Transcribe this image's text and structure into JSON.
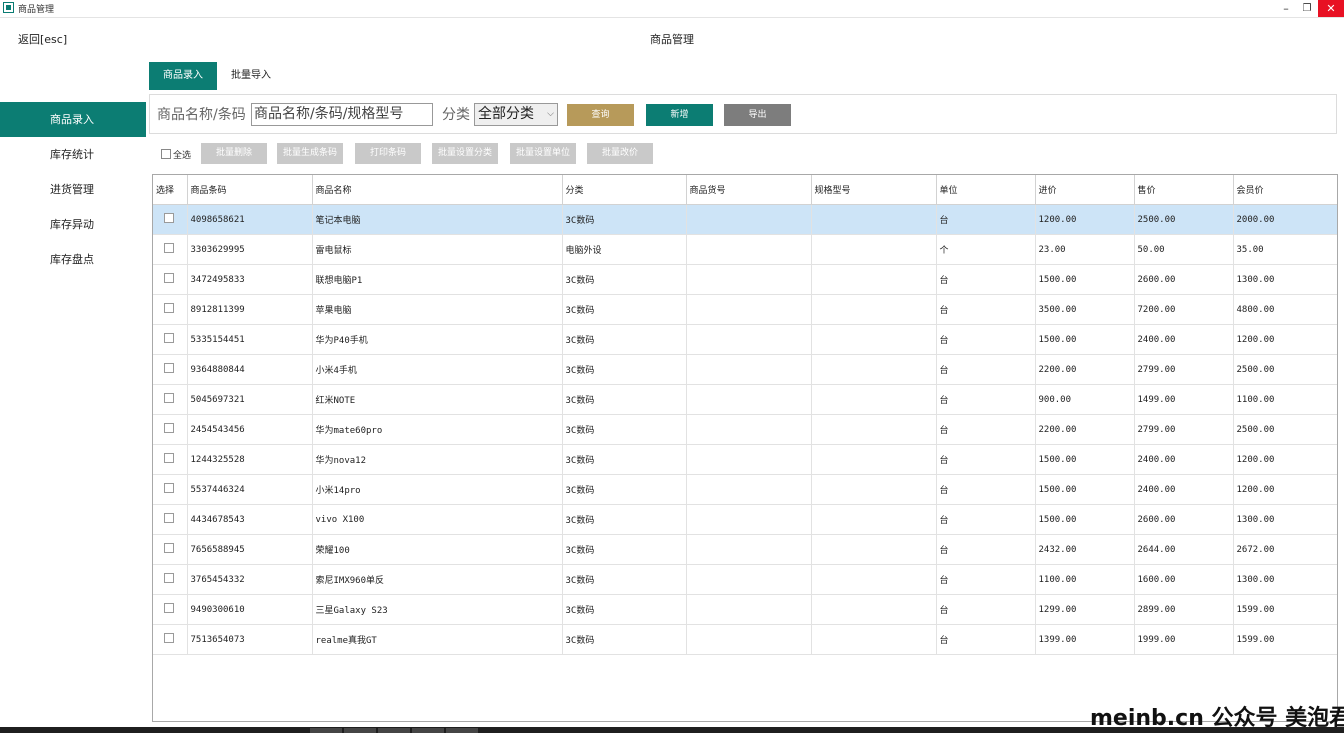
{
  "window": {
    "title": "商品管理",
    "min": "–",
    "restore": "❐",
    "close": "✕"
  },
  "header": {
    "back": "返回[esc]",
    "title": "商品管理"
  },
  "sidebar": {
    "items": [
      "商品录入",
      "库存统计",
      "进货管理",
      "库存异动",
      "库存盘点"
    ]
  },
  "tabs": [
    "商品录入",
    "批量导入"
  ],
  "filter": {
    "search_label": "商品名称/条码",
    "search_value": "商品名称/条码/规格型号",
    "category_label": "分类",
    "category_value": "全部分类",
    "query": "查询",
    "add": "新增",
    "export": "导出"
  },
  "bulk": {
    "select_all": "全选",
    "buttons": [
      "批量删除",
      "批量生成条码",
      "打印条码",
      "批量设置分类",
      "批量设置单位",
      "批量改价"
    ]
  },
  "table": {
    "columns": [
      "选择",
      "商品条码",
      "商品名称",
      "分类",
      "商品货号",
      "规格型号",
      "单位",
      "进价",
      "售价",
      "会员价"
    ],
    "rows": [
      [
        "4098658621",
        "笔记本电脑",
        "3C数码",
        "",
        "",
        "台",
        "1200.00",
        "2500.00",
        "2000.00"
      ],
      [
        "3303629995",
        "雷电鼠标",
        "电脑外设",
        "",
        "",
        "个",
        "23.00",
        "50.00",
        "35.00"
      ],
      [
        "3472495833",
        "联想电脑P1",
        "3C数码",
        "",
        "",
        "台",
        "1500.00",
        "2600.00",
        "1300.00"
      ],
      [
        "8912811399",
        "苹果电脑",
        "3C数码",
        "",
        "",
        "台",
        "3500.00",
        "7200.00",
        "4800.00"
      ],
      [
        "5335154451",
        "华为P40手机",
        "3C数码",
        "",
        "",
        "台",
        "1500.00",
        "2400.00",
        "1200.00"
      ],
      [
        "9364880844",
        "小米4手机",
        "3C数码",
        "",
        "",
        "台",
        "2200.00",
        "2799.00",
        "2500.00"
      ],
      [
        "5045697321",
        "红米NOTE",
        "3C数码",
        "",
        "",
        "台",
        "900.00",
        "1499.00",
        "1100.00"
      ],
      [
        "2454543456",
        "华为mate60pro",
        "3C数码",
        "",
        "",
        "台",
        "2200.00",
        "2799.00",
        "2500.00"
      ],
      [
        "1244325528",
        "华为nova12",
        "3C数码",
        "",
        "",
        "台",
        "1500.00",
        "2400.00",
        "1200.00"
      ],
      [
        "5537446324",
        "小米14pro",
        "3C数码",
        "",
        "",
        "台",
        "1500.00",
        "2400.00",
        "1200.00"
      ],
      [
        "4434678543",
        "vivo X100",
        "3C数码",
        "",
        "",
        "台",
        "1500.00",
        "2600.00",
        "1300.00"
      ],
      [
        "7656588945",
        "荣耀100",
        "3C数码",
        "",
        "",
        "台",
        "2432.00",
        "2644.00",
        "2672.00"
      ],
      [
        "3765454332",
        "索尼IMX960单反",
        "3C数码",
        "",
        "",
        "台",
        "1100.00",
        "1600.00",
        "1300.00"
      ],
      [
        "9490300610",
        "三星Galaxy S23",
        "3C数码",
        "",
        "",
        "台",
        "1299.00",
        "2899.00",
        "1599.00"
      ],
      [
        "7513654073",
        "realme真我GT",
        "3C数码",
        "",
        "",
        "台",
        "1399.00",
        "1999.00",
        "1599.00"
      ]
    ]
  },
  "watermark": "meinb.cn 公众号 美泡君",
  "colors": {
    "accent": "#0c7d73",
    "query": "#b79a5a",
    "export": "#7d7d7d",
    "disabled": "#c9c9c9",
    "row_selected": "#cde4f7"
  }
}
